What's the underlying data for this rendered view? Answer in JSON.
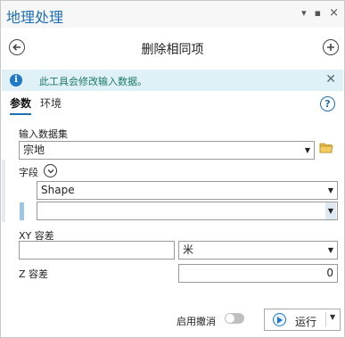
{
  "window": {
    "title": "地理处理",
    "controls": [
      "pin-icon",
      "autohide-icon",
      "close-icon"
    ]
  },
  "tool": {
    "title": "删除相同项"
  },
  "info_banner": {
    "text": "此工具会修改输入数据。",
    "icon": "info-icon"
  },
  "tabs": [
    {
      "label": "参数",
      "active": true
    },
    {
      "label": "环境",
      "active": false
    }
  ],
  "params": {
    "input_dataset": {
      "label": "输入数据集",
      "value": "宗地"
    },
    "fields": {
      "label": "字段",
      "rows": [
        "Shape",
        ""
      ]
    },
    "xy_tolerance": {
      "label": "XY 容差",
      "value": "",
      "unit": "米"
    },
    "z_tolerance": {
      "label": "Z 容差",
      "value": "0"
    }
  },
  "footer": {
    "undo_label": "启用撤消",
    "undo_enabled": false,
    "run_label": "运行"
  },
  "colors": {
    "accent": "#1f6fb5",
    "info_bg": "#dff0f7",
    "info_text": "#1d7a63"
  }
}
